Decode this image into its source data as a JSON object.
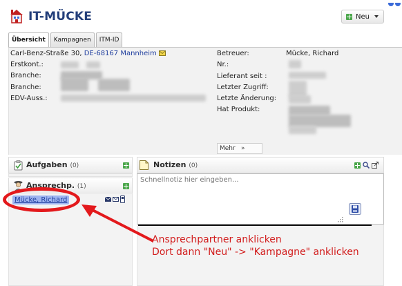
{
  "header": {
    "title": "IT-MÜCKE",
    "new_button_label": "Neu"
  },
  "tabs": [
    {
      "label": "Übersicht",
      "active": true
    },
    {
      "label": "Kampagnen",
      "active": false
    },
    {
      "label": "ITM-ID",
      "active": false
    }
  ],
  "info": {
    "address_street": "Carl-Benz-Straße 30,",
    "address_city": "DE-68167 Mannheim",
    "left_labels": [
      "Erstkont.:",
      "Branche:",
      "Branche:",
      "EDV-Auss.:"
    ],
    "right_labels": [
      "Betreuer:",
      "Nr.:",
      "Lieferant seit :",
      "Letzter Zugriff:",
      "Letzte Änderung:",
      "Hat Produkt:"
    ],
    "betreuer_value": "Mücke, Richard",
    "more_button_label": "Mehr"
  },
  "sidebar": {
    "tasks": {
      "label": "Aufgaben",
      "count": "(0)"
    },
    "contacts": {
      "label": "Ansprechp.",
      "count": "(1)",
      "items": [
        {
          "name": "Mücke, Richard"
        }
      ]
    }
  },
  "notes": {
    "label": "Notizen",
    "count": "(0)",
    "placeholder": "Schnellnotiz hier eingeben..."
  },
  "annotation": {
    "line1": "Ansprechpartner anklicken",
    "line2": "Dort dann \"Neu\" -> \"Kampagne\" anklicken",
    "color": "#d21d1d"
  },
  "colors": {
    "title": "#243f7a",
    "link": "#1f3e9e",
    "highlight_oval": "#e3191c",
    "add_icon": "#4aa64a"
  }
}
